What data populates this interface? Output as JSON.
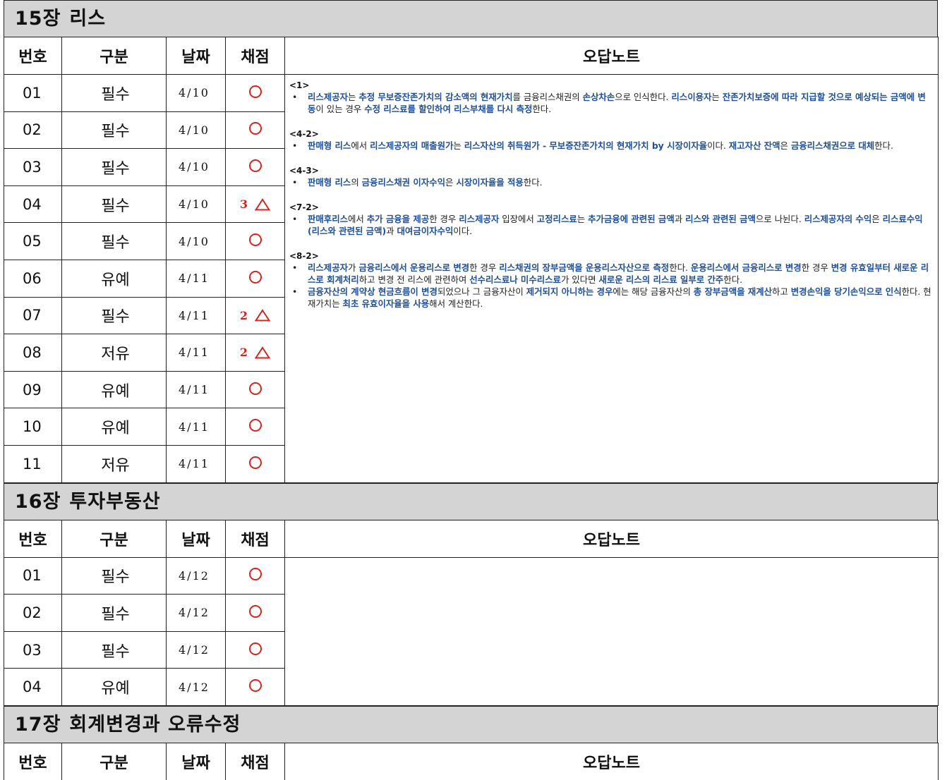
{
  "headers": {
    "num": "번호",
    "cat": "구분",
    "date": "날짜",
    "grade": "채점",
    "note": "오답노트"
  },
  "sections": [
    {
      "chapter": "15장",
      "title": "리스",
      "rows": [
        {
          "num": "01",
          "cat": "필수",
          "date": "4/10",
          "grade": "○",
          "count": ""
        },
        {
          "num": "02",
          "cat": "필수",
          "date": "4/10",
          "grade": "○",
          "count": ""
        },
        {
          "num": "03",
          "cat": "필수",
          "date": "4/10",
          "grade": "○",
          "count": ""
        },
        {
          "num": "04",
          "cat": "필수",
          "date": "4/10",
          "grade": "△",
          "count": "3"
        },
        {
          "num": "05",
          "cat": "필수",
          "date": "4/10",
          "grade": "○",
          "count": ""
        },
        {
          "num": "06",
          "cat": "유예",
          "date": "4/11",
          "grade": "○",
          "count": ""
        },
        {
          "num": "07",
          "cat": "필수",
          "date": "4/11",
          "grade": "△",
          "count": "2"
        },
        {
          "num": "08",
          "cat": "저유",
          "date": "4/11",
          "grade": "△",
          "count": "2"
        },
        {
          "num": "09",
          "cat": "유예",
          "date": "4/11",
          "grade": "○",
          "count": ""
        },
        {
          "num": "10",
          "cat": "유예",
          "date": "4/11",
          "grade": "○",
          "count": ""
        },
        {
          "num": "11",
          "cat": "저유",
          "date": "4/11",
          "grade": "○",
          "count": ""
        }
      ],
      "notes": [
        {
          "tag": "<1>",
          "items": [
            [
              [
                "b",
                "리스제공자"
              ],
              [
                "n",
                "는 "
              ],
              [
                "b",
                "추정 무보증잔존가치의 감소액의 현재가치"
              ],
              [
                "n",
                "를 금융리스채권의 "
              ],
              [
                "b",
                "손상차손"
              ],
              [
                "n",
                "으로 인식한다. "
              ],
              [
                "b",
                "리스이용자"
              ],
              [
                "n",
                "는 "
              ],
              [
                "b",
                "잔존가치보증에 따라 지급할 것으로 예상되는 금액에 변동"
              ],
              [
                "n",
                "이 있는 경우 "
              ],
              [
                "b",
                "수정 리스료를 할인하여 리스부채를 다시 측정"
              ],
              [
                "n",
                "한다."
              ]
            ]
          ]
        },
        {
          "tag": "<4-2>",
          "items": [
            [
              [
                "b",
                "판매형 리스"
              ],
              [
                "n",
                "에서 "
              ],
              [
                "b",
                "리스제공자의 매출원가"
              ],
              [
                "n",
                "는 "
              ],
              [
                "b",
                "리스자산의 취득원가 - 무보증잔존가치의 현재가치 by 시장이자율"
              ],
              [
                "n",
                "이다. "
              ],
              [
                "b",
                "재고자산 잔액"
              ],
              [
                "n",
                "은 "
              ],
              [
                "b",
                "금융리스채권으로 대체"
              ],
              [
                "n",
                "한다."
              ]
            ]
          ]
        },
        {
          "tag": "<4-3>",
          "items": [
            [
              [
                "b",
                "판매형 리스"
              ],
              [
                "n",
                "의 "
              ],
              [
                "b",
                "금융리스채권 이자수익"
              ],
              [
                "n",
                "은 "
              ],
              [
                "b",
                "시장이자율을 적용"
              ],
              [
                "n",
                "한다."
              ]
            ]
          ]
        },
        {
          "tag": "<7-2>",
          "items": [
            [
              [
                "b",
                "판매후리스"
              ],
              [
                "n",
                "에서 "
              ],
              [
                "b",
                "추가 금융을 제공"
              ],
              [
                "n",
                "한 경우 "
              ],
              [
                "b",
                "리스제공자"
              ],
              [
                "n",
                " 입장에서 "
              ],
              [
                "b",
                "고정리스료"
              ],
              [
                "n",
                "는 "
              ],
              [
                "b",
                "추가금융에 관련된 금액"
              ],
              [
                "n",
                "과 "
              ],
              [
                "b",
                "리스와 관련된 금액"
              ],
              [
                "n",
                "으로 나뉜다. "
              ],
              [
                "b",
                "리스제공자의 수익"
              ],
              [
                "n",
                "은 "
              ],
              [
                "b",
                "리스료수익(리스와 관련된 금액)"
              ],
              [
                "n",
                "과 "
              ],
              [
                "b",
                "대여금이자수익"
              ],
              [
                "n",
                "이다."
              ]
            ]
          ]
        },
        {
          "tag": "<8-2>",
          "items": [
            [
              [
                "b",
                "리스제공자"
              ],
              [
                "n",
                "가 "
              ],
              [
                "b",
                "금융리스에서 운용리스로 변경"
              ],
              [
                "n",
                "한 경우 "
              ],
              [
                "b",
                "리스채권의 장부금액을 운용리스자산으로 측정"
              ],
              [
                "n",
                "한다. "
              ],
              [
                "b",
                "운용리스에서 금융리스로 변경"
              ],
              [
                "n",
                "한 경우 "
              ],
              [
                "b",
                "변경 유효일부터 새로운 리스로 회계처리"
              ],
              [
                "n",
                "하고 변경 전 리스에 관련하여 "
              ],
              [
                "b",
                "선수리스료나 미수리스료"
              ],
              [
                "n",
                "가 있다면 "
              ],
              [
                "b",
                "새로운 리스의 리스료 일부로 간주"
              ],
              [
                "n",
                "한다."
              ]
            ],
            [
              [
                "b",
                "금융자산의 계약상 현금흐름이 변경"
              ],
              [
                "n",
                "되었으나 그 금융자산이 "
              ],
              [
                "b",
                "제거되지 아니하는 경우"
              ],
              [
                "n",
                "에는 해당 금융자산의 "
              ],
              [
                "b",
                "총 장부금액을 재계산"
              ],
              [
                "n",
                "하고 "
              ],
              [
                "b",
                "변경손익을 당기손익으로 인식"
              ],
              [
                "n",
                "한다. 현재가치는 "
              ],
              [
                "b",
                "최초 유효이자율을 사용"
              ],
              [
                "n",
                "해서 계산한다."
              ]
            ]
          ]
        }
      ]
    },
    {
      "chapter": "16장",
      "title": "투자부동산",
      "rows": [
        {
          "num": "01",
          "cat": "필수",
          "date": "4/12",
          "grade": "○",
          "count": ""
        },
        {
          "num": "02",
          "cat": "필수",
          "date": "4/12",
          "grade": "○",
          "count": ""
        },
        {
          "num": "03",
          "cat": "필수",
          "date": "4/12",
          "grade": "○",
          "count": ""
        },
        {
          "num": "04",
          "cat": "유예",
          "date": "4/12",
          "grade": "○",
          "count": ""
        }
      ],
      "notes": []
    },
    {
      "chapter": "17장",
      "title": "회계변경과 오류수정",
      "rows": [],
      "notes": []
    }
  ]
}
